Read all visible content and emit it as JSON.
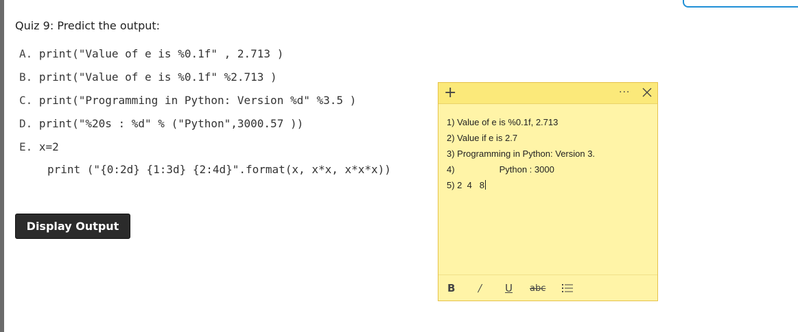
{
  "quiz": {
    "title": "Quiz 9: Predict the output:",
    "options": [
      {
        "letter": "A.",
        "code": "print(\"Value of e is %0.1f\" , 2.713 )"
      },
      {
        "letter": "B.",
        "code": "print(\"Value of e is %0.1f\" %2.713 )"
      },
      {
        "letter": "C.",
        "code": "print(\"Programming in Python: Version %d\" %3.5 )"
      },
      {
        "letter": "D.",
        "code": "print(\"%20s : %d\" % (\"Python\",3000.57 ))"
      },
      {
        "letter": "E.",
        "code": "x=2"
      }
    ],
    "option_e_line2": "print (\"{0:2d} {1:3d} {2:4d}\".format(x, x*x, x*x*x))",
    "button_label": "Display Output"
  },
  "sticky_note": {
    "lines": [
      "1) Value of e is %0.1f, 2.713",
      "2) Value if e is 2.7",
      "3) Programming in Python: Version 3.",
      "4)                  Python : 3000",
      "5) 2  4   8"
    ],
    "header_icons": [
      "plus-icon",
      "more-icon",
      "close-icon"
    ],
    "toolbar": {
      "bold": "B",
      "italic": "/",
      "underline": "U",
      "strikethrough": "abc",
      "list_icon": "bullet-list-icon"
    }
  },
  "colors": {
    "note_bg": "#fff4a7",
    "note_header": "#fbe97a",
    "button_bg": "#2b2b2b"
  }
}
